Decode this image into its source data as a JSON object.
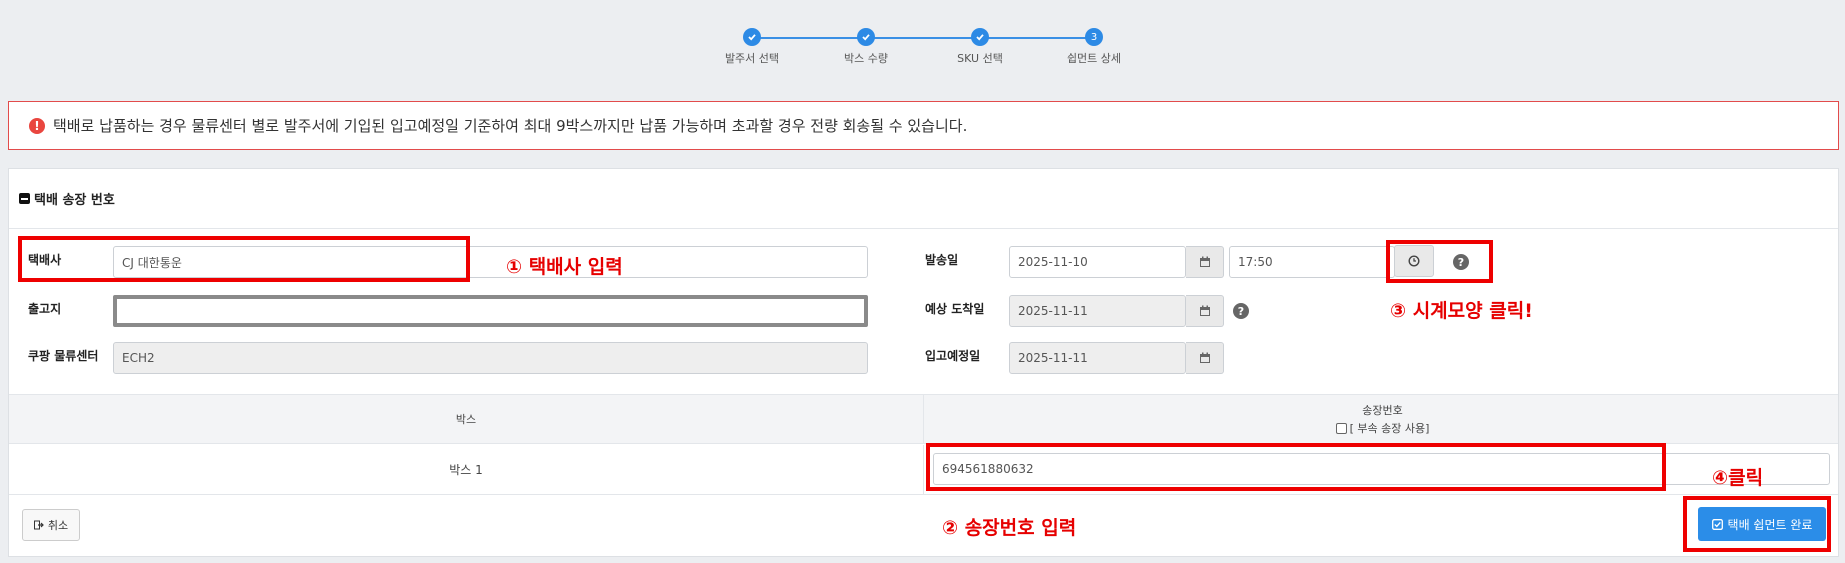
{
  "stepper": {
    "steps": [
      {
        "label": "발주서 선택",
        "state": "done"
      },
      {
        "label": "박스 수량",
        "state": "done"
      },
      {
        "label": "SKU 선택",
        "state": "done"
      },
      {
        "label": "쉽먼트 상세",
        "state": "current",
        "number": "3"
      }
    ]
  },
  "alert": {
    "icon": "exclamation-icon",
    "text": "택배로 납품하는 경우 물류센터 별로 발주서에 기입된 입고예정일 기준하여 최대 9박스까지만 납품 가능하며 초과할 경우 전량 회송될 수 있습니다."
  },
  "panel": {
    "title": "택배 송장 번호",
    "courier_label": "택배사",
    "courier_value": "CJ 대한통운",
    "origin_label": "출고지",
    "origin_value": "",
    "center_label": "쿠팡 물류센터",
    "center_value": "ECH2",
    "ship_date_label": "발송일",
    "ship_date_value": "2025-11-10",
    "ship_time_value": "17:50",
    "eta_label": "예상 도착일",
    "eta_value": "2025-11-11",
    "inbound_label": "입고예정일",
    "inbound_value": "2025-11-11"
  },
  "table": {
    "col_box": "박스",
    "col_invoice": "송장번호",
    "sub_invoice_label": "[ 부속 송장 사용]",
    "rows": [
      {
        "box": "박스 1",
        "invoice": "694561880632"
      }
    ]
  },
  "buttons": {
    "cancel": "취소",
    "complete": "택배 쉽먼트 완료"
  },
  "annotations": {
    "a1": "① 택배사 입력",
    "a2": "② 송장번호 입력",
    "a3": "③ 시계모양 클릭!",
    "a4": "④클릭"
  },
  "colors": {
    "accent": "#2b8de8",
    "annotation_red": "#ee0000",
    "alert_border": "#e24b4b"
  }
}
